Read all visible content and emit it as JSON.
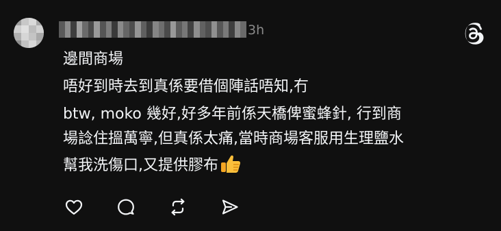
{
  "post": {
    "time": "3h",
    "title": "邊間商場",
    "lines": [
      "唔好到時去到真係要借個陣話唔知,冇",
      "btw, moko 幾好,好多年前係天橋俾蜜蜂針, 行到商",
      "場諗住搵萬寧,但真係太痛,當時商場客服用生理鹽水",
      "幫我洗傷口,又提供膠布"
    ],
    "emoji": "thumbs-up-emoji"
  },
  "actions": [
    {
      "name": "like-button",
      "icon": "heart-icon"
    },
    {
      "name": "reply-button",
      "icon": "comment-bubble-icon"
    },
    {
      "name": "repost-button",
      "icon": "repost-icon"
    },
    {
      "name": "share-button",
      "icon": "send-icon"
    }
  ],
  "brand": {
    "logo": "threads-logo-icon",
    "accent": "#f3f5f7",
    "background": "#101010"
  }
}
